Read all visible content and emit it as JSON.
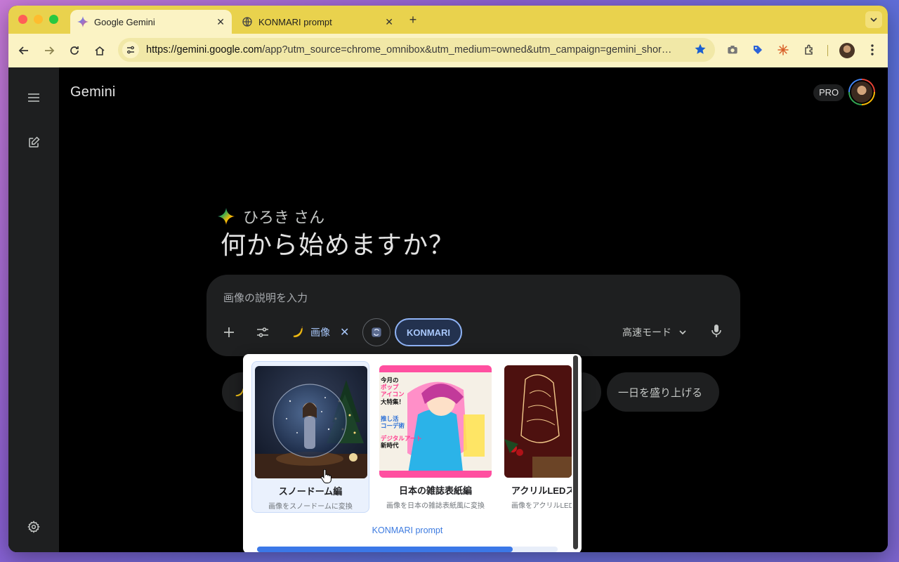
{
  "browser": {
    "tabs": [
      {
        "title": "Google Gemini",
        "close": "✕"
      },
      {
        "title": "KONMARI prompt",
        "close": "✕"
      }
    ],
    "new_tab": "+",
    "url_host": "https://gemini.google.com",
    "url_path": "/app?utm_source=chrome_omnibox&utm_medium=owned&utm_campaign=gemini_shor…"
  },
  "app": {
    "brand": "Gemini",
    "plan_badge": "PRO",
    "greeting_name": "ひろき さん",
    "headline": "何から始めますか？",
    "prompt": {
      "placeholder": "画像の説明を入力",
      "image_chip_label": "画像",
      "image_chip_close": "✕",
      "konmari_label": "KONMARI",
      "mode_label": "高速モード"
    },
    "suggestions": [
      {
        "label": "一日を盛り上げる"
      }
    ]
  },
  "popup": {
    "cards": [
      {
        "title": "スノードーム編",
        "desc": "画像をスノードームに変換"
      },
      {
        "title": "日本の雑誌表紙編",
        "desc": "画像を日本の雑誌表紙風に変換"
      },
      {
        "title": "アクリルLEDス",
        "desc": "画像をアクリルLED"
      }
    ],
    "magazine_lines": [
      "今月の",
      "ポップ",
      "アイコン",
      "大特集！",
      "推し活",
      "コーデ術",
      "デジタルアート",
      "新時代"
    ],
    "link_label": "KONMARI prompt",
    "scroll_progress": 0.85
  }
}
